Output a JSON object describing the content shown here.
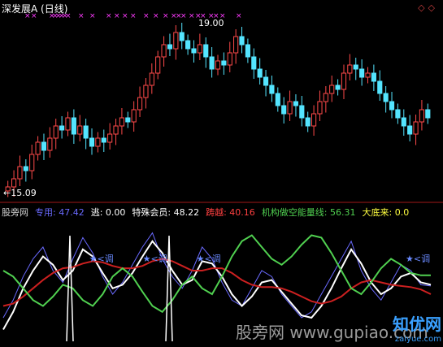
{
  "header": {
    "title": "深发展A (日线)",
    "title_color": "#ffffff"
  },
  "top_panel": {
    "high_label": "19.00",
    "low_label": "←15.09",
    "up_color": "#ff4a4a",
    "down_color": "#54e5ff",
    "marker_color": "#ff3cff"
  },
  "indicator_header": {
    "items": [
      {
        "label": "股旁网",
        "value": "",
        "color": "#d0d0d0"
      },
      {
        "label": "专用:",
        "value": "47.42",
        "color": "#6a6aff"
      },
      {
        "label": "逃:",
        "value": "0.00",
        "color": "#ffffff"
      },
      {
        "label": "特殊会员:",
        "value": "48.22",
        "color": "#ffffff"
      },
      {
        "label": "踌越:",
        "value": "40.16",
        "color": "#ff4040"
      },
      {
        "label": "机构做空能量线:",
        "value": "56.31",
        "color": "#50d050"
      },
      {
        "label": "大底来:",
        "value": "0.0",
        "color": "#ffff40"
      }
    ]
  },
  "annotations": [
    {
      "text": "★<调",
      "x_index": 32
    },
    {
      "text": "★<调",
      "x_index": 52
    },
    {
      "text": "★<调",
      "x_index": 72
    },
    {
      "text": "★<调",
      "x_index": 150
    }
  ],
  "watermark": {
    "text": "股旁网 www.gupiao.com",
    "brand": "知优网",
    "brand_sub": "zaiyue.com"
  },
  "chart_data": [
    {
      "type": "candlestick",
      "title": "深发展A (日线)",
      "ylim": [
        15.0,
        19.2
      ],
      "series": [
        {
          "name": "price",
          "values": [
            15.1,
            15.3,
            15.6,
            15.5,
            15.9,
            16.2,
            16.0,
            16.3,
            16.6,
            16.5,
            16.8,
            16.4,
            16.6,
            16.3,
            16.1,
            16.3,
            16.2,
            16.4,
            16.6,
            16.8,
            16.7,
            17.0,
            17.3,
            17.6,
            17.9,
            18.3,
            18.6,
            18.5,
            18.9,
            18.7,
            18.5,
            18.4,
            18.6,
            18.3,
            18.0,
            18.2,
            18.1,
            18.4,
            18.8,
            18.6,
            18.3,
            18.0,
            17.8,
            17.6,
            17.4,
            17.1,
            16.9,
            17.2,
            17.1,
            16.8,
            16.6,
            16.9,
            17.2,
            17.4,
            17.6,
            17.5,
            17.9,
            18.1,
            18.0,
            17.8,
            17.9,
            17.7,
            17.4,
            17.2,
            17.0,
            16.8,
            16.6,
            16.4,
            16.7,
            17.0,
            16.8
          ]
        }
      ]
    },
    {
      "type": "line",
      "ylim": [
        0,
        100
      ],
      "series": [
        {
          "name": "专用",
          "color": "#6a6aff",
          "values": [
            20,
            35,
            55,
            70,
            80,
            60,
            50,
            70,
            88,
            75,
            55,
            40,
            50,
            65,
            80,
            92,
            70,
            55,
            45,
            60,
            80,
            70,
            50,
            35,
            30,
            45,
            60,
            55,
            40,
            30,
            20,
            25,
            40,
            55,
            70,
            85,
            60,
            45,
            35,
            50,
            65,
            60,
            48,
            47
          ]
        },
        {
          "name": "特殊会员",
          "color": "#ffffff",
          "values": [
            10,
            25,
            45,
            60,
            72,
            65,
            52,
            60,
            78,
            72,
            58,
            45,
            48,
            58,
            72,
            85,
            75,
            60,
            48,
            52,
            68,
            66,
            55,
            40,
            30,
            38,
            50,
            52,
            42,
            32,
            22,
            20,
            30,
            45,
            62,
            78,
            66,
            50,
            40,
            45,
            55,
            58,
            50,
            48
          ]
        },
        {
          "name": "踌越",
          "color": "#cc2020",
          "values": [
            30,
            32,
            38,
            45,
            52,
            58,
            62,
            63,
            66,
            68,
            67,
            64,
            62,
            62,
            64,
            68,
            70,
            68,
            64,
            60,
            60,
            62,
            62,
            58,
            52,
            48,
            46,
            46,
            45,
            42,
            38,
            34,
            32,
            34,
            38,
            45,
            50,
            52,
            50,
            48,
            47,
            46,
            44,
            40
          ]
        },
        {
          "name": "机构做空能量线",
          "color": "#50d050",
          "values": [
            60,
            55,
            45,
            35,
            30,
            38,
            48,
            45,
            35,
            30,
            40,
            55,
            62,
            55,
            42,
            30,
            25,
            35,
            48,
            55,
            45,
            40,
            55,
            72,
            85,
            90,
            80,
            70,
            65,
            72,
            82,
            90,
            88,
            75,
            60,
            45,
            40,
            50,
            62,
            70,
            65,
            58,
            56,
            56
          ]
        }
      ]
    }
  ]
}
